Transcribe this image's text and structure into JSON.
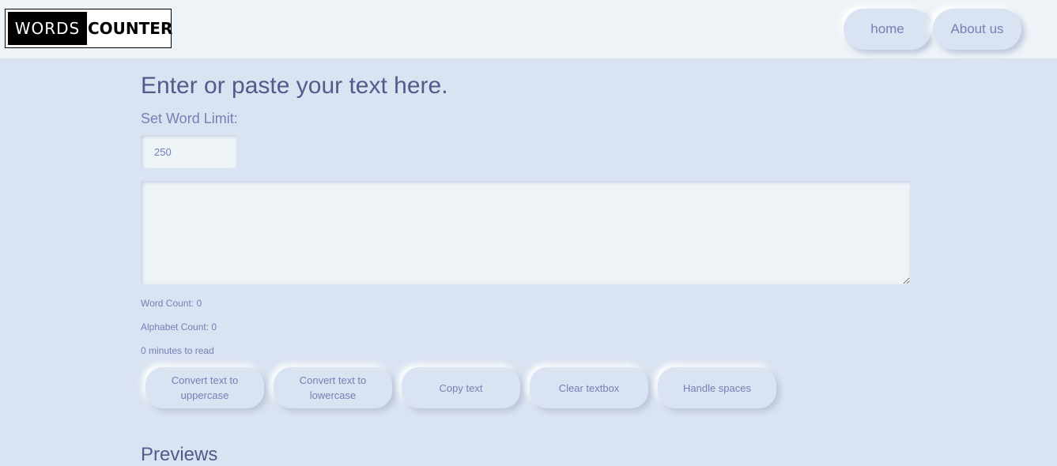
{
  "header": {
    "logo_words": "WORDS",
    "logo_counter": "COUNTER",
    "nav": [
      {
        "label": "home"
      },
      {
        "label": "About us"
      }
    ]
  },
  "main": {
    "title": "Enter or paste your text here.",
    "word_limit_label": "Set Word Limit:",
    "word_limit_value": "250",
    "textarea_value": "",
    "stats": {
      "word_count_label": "Word Count:",
      "word_count": "0",
      "alphabet_count_label": "Alphabet Count:",
      "alphabet_count": "0",
      "read_time_value": "0",
      "read_time_suffix": "minutes to read"
    },
    "buttons": [
      {
        "label": "Convert text to uppercase"
      },
      {
        "label": "Convert text to lowercase"
      },
      {
        "label": "Copy text"
      },
      {
        "label": "Clear textbox"
      },
      {
        "label": "Handle spaces"
      }
    ],
    "previews_title": "Previews"
  }
}
